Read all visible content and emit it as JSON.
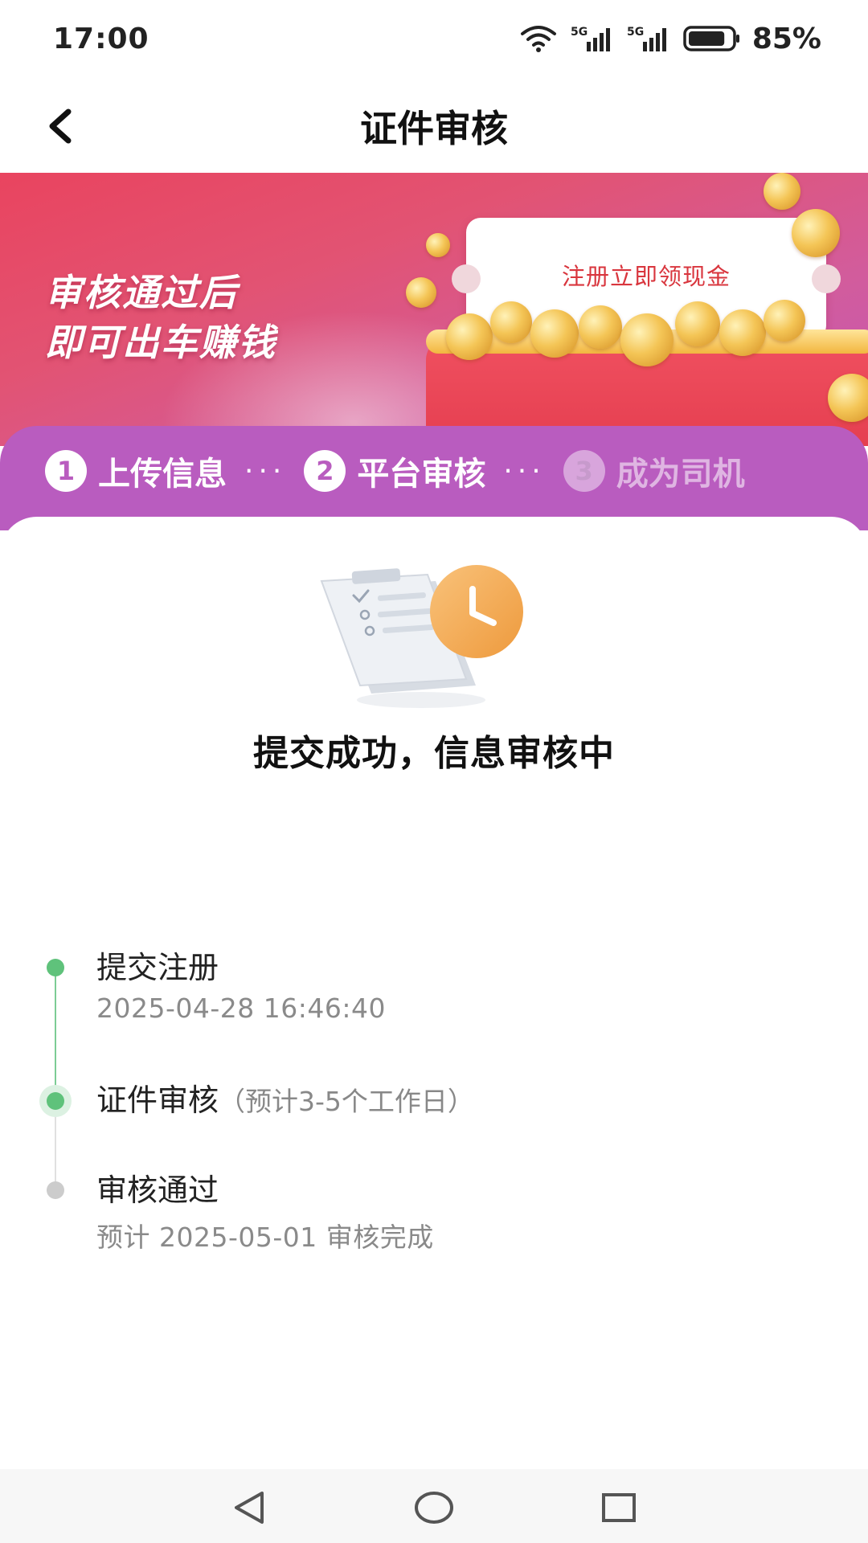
{
  "status_bar": {
    "time": "17:00",
    "battery_percent": "85%",
    "battery_level": 0.85,
    "icons": [
      "wifi-icon",
      "signal-5g-icon",
      "signal-5g-icon",
      "battery-icon"
    ]
  },
  "header": {
    "title": "证件审核",
    "back_icon": "chevron-left-icon"
  },
  "banner": {
    "slogan_line1": "审核通过后",
    "slogan_line2": "即可出车赚钱",
    "ticket_text": "注册立即领现金"
  },
  "steps": [
    {
      "number": "1",
      "label": "上传信息",
      "state": "done"
    },
    {
      "number": "2",
      "label": "平台审核",
      "state": "current"
    },
    {
      "number": "3",
      "label": "成为司机",
      "state": "pending"
    }
  ],
  "step_separator": "···",
  "status": {
    "title": "提交成功，信息审核中",
    "illustration": "document-clock-icon"
  },
  "timeline": {
    "items": [
      {
        "title": "提交注册",
        "note": "",
        "sub": "2025-04-28 16:46:40",
        "state": "done"
      },
      {
        "title": "证件审核",
        "note": "（预计3-5个工作日）",
        "sub": "",
        "state": "current"
      },
      {
        "title": "审核通过",
        "note": "",
        "sub": "预计 2025-05-01 审核完成",
        "state": "pending"
      }
    ]
  },
  "nav_bar": {
    "icons": [
      "back-triangle-icon",
      "home-circle-icon",
      "recents-square-icon"
    ]
  },
  "colors": {
    "accent_green": "#5fc27b",
    "banner_red": "#e9445f",
    "steps_purple": "#b95cbf",
    "ticket_red": "#d9363e"
  }
}
